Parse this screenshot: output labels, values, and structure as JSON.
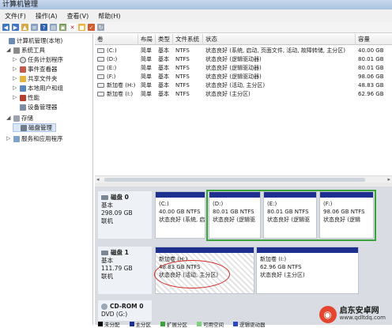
{
  "window": {
    "title": "计算机管理"
  },
  "menu": [
    "文件(F)",
    "操作(A)",
    "查看(V)",
    "帮助(H)"
  ],
  "tree": [
    {
      "label": "计算机管理(本地)",
      "level": 0,
      "icon": "computer-icon",
      "exp": ""
    },
    {
      "label": "系统工具",
      "level": 1,
      "icon": "tools-icon",
      "exp": "◢"
    },
    {
      "label": "任务计划程序",
      "level": 2,
      "icon": "clock-icon",
      "exp": "▷"
    },
    {
      "label": "事件查看器",
      "level": 2,
      "icon": "event-icon",
      "exp": "▷"
    },
    {
      "label": "共享文件夹",
      "level": 2,
      "icon": "folder-icon",
      "exp": "▷"
    },
    {
      "label": "本地用户和组",
      "level": 2,
      "icon": "users-icon",
      "exp": "▷"
    },
    {
      "label": "性能",
      "level": 2,
      "icon": "performance-icon",
      "exp": "▷"
    },
    {
      "label": "设备管理器",
      "level": 2,
      "icon": "device-icon",
      "exp": ""
    },
    {
      "label": "存储",
      "level": 1,
      "icon": "storage-icon",
      "exp": "◢"
    },
    {
      "label": "磁盘管理",
      "level": 2,
      "icon": "disk-icon",
      "exp": "",
      "selected": true
    },
    {
      "label": "服务和应用程序",
      "level": 1,
      "icon": "services-icon",
      "exp": "▷"
    }
  ],
  "columns": [
    "卷",
    "布局",
    "类型",
    "文件系统",
    "状态",
    "容量"
  ],
  "volumes": [
    {
      "vol": "(C:)",
      "layout": "简单",
      "type": "基本",
      "fs": "NTFS",
      "status": "状态良好 (系统, 启动, 页面文件, 活动, 故障转储, 主分区)",
      "cap": "40.00 GB"
    },
    {
      "vol": "(D:)",
      "layout": "简单",
      "type": "基本",
      "fs": "NTFS",
      "status": "状态良好 (逻辑驱动器)",
      "cap": "80.01 GB"
    },
    {
      "vol": "(E:)",
      "layout": "简单",
      "type": "基本",
      "fs": "NTFS",
      "status": "状态良好 (逻辑驱动器)",
      "cap": "80.01 GB"
    },
    {
      "vol": "(F:)",
      "layout": "简单",
      "type": "基本",
      "fs": "NTFS",
      "status": "状态良好 (逻辑驱动器)",
      "cap": "98.06 GB"
    },
    {
      "vol": "新加卷 (H:)",
      "layout": "简单",
      "type": "基本",
      "fs": "NTFS",
      "status": "状态良好 (活动, 主分区)",
      "cap": "48.83 GB"
    },
    {
      "vol": "新加卷 (I:)",
      "layout": "简单",
      "type": "基本",
      "fs": "NTFS",
      "status": "状态良好 (主分区)",
      "cap": "62.96 GB"
    }
  ],
  "disks": [
    {
      "name": "磁盘 0",
      "type": "基本",
      "size": "298.09 GB",
      "state": "联机",
      "parts": [
        {
          "title": "(C:)",
          "size": "40.00 GB NTFS",
          "status": "状态良好 (系统, 启"
        },
        {
          "title": "(D:)",
          "size": "80.01 GB NTFS",
          "status": "状态良好 (逻辑驱"
        },
        {
          "title": "(E:)",
          "size": "80.01 GB NTFS",
          "status": "状态良好 (逻辑驱"
        },
        {
          "title": "(F:)",
          "size": "98.06 GB NTFS",
          "status": "状态良好 (逻辑"
        }
      ]
    },
    {
      "name": "磁盘 1",
      "type": "基本",
      "size": "111.79 GB",
      "state": "联机",
      "parts": [
        {
          "title": "新加卷 (H:)",
          "size": "48.83 GB NTFS",
          "status": "状态良好 (活动, 主分区)"
        },
        {
          "title": "新加卷 (I:)",
          "size": "62.96 GB NTFS",
          "status": "状态良好 (主分区)"
        }
      ]
    },
    {
      "name": "CD-ROM 0",
      "type": "DVD (G:)"
    }
  ],
  "legend": [
    "未分配",
    "主分区",
    "扩展分区",
    "可用空间",
    "逻辑驱动器"
  ],
  "watermark": {
    "title": "启东安卓网",
    "url": "www.qdltdq.com"
  },
  "colors": {
    "primary": "#1d2f8f",
    "extended": "#3aa33a",
    "highlight": "#d02828"
  }
}
